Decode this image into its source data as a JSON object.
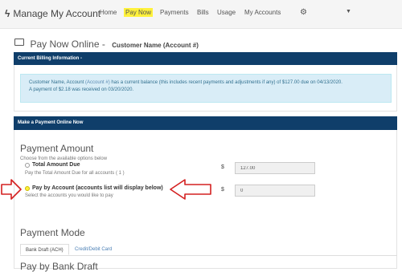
{
  "brand": {
    "icon": "bolt-icon",
    "title": "Manage My Account"
  },
  "nav": {
    "items": [
      "Home",
      "Pay Now",
      "Payments",
      "Bills",
      "Usage",
      "My Accounts"
    ],
    "active": "Pay Now",
    "settings_icon": "gear-icon",
    "dropdown_icon": "caret-down-icon"
  },
  "page": {
    "title": "Pay Now Online -",
    "subtitle": "Customer Name (Account #)"
  },
  "billing": {
    "header": "Current Billing Information -",
    "line1_name": "Customer Name, Account",
    "line1_account": "(Account #)",
    "line1_rest": "has a current balance (this includes recent payments and adjustments if any) of $127.00 due on 04/13/2020.",
    "line2": "A payment of $2.18 was received on 03/20/2020."
  },
  "payment_panel": {
    "header": "Make a Payment Online Now"
  },
  "payment_amount": {
    "heading": "Payment Amount",
    "instructions": "Choose from the available options below",
    "options": [
      {
        "label": "Total Amount Due",
        "help": "Pay the Total Amount Due for all accounts ( 1 )",
        "currency": "$",
        "value": "127.00",
        "selected": false
      },
      {
        "label": "Pay by Account (accounts list will display below)",
        "help": "Select the accounts you would like to pay",
        "currency": "$",
        "value": "0",
        "selected": true
      }
    ]
  },
  "payment_mode": {
    "heading": "Payment Mode",
    "tabs": [
      {
        "label": "Bank Draft (ACH)",
        "active": true
      },
      {
        "label": "Credit/Debit Card",
        "active": false
      }
    ]
  },
  "bank_draft": {
    "heading": "Pay by Bank Draft"
  },
  "colors": {
    "header_bg": "#0f3e6a",
    "highlight": "#fff13b",
    "annotation": "#d42020",
    "alert_bg": "#d9edf7"
  }
}
